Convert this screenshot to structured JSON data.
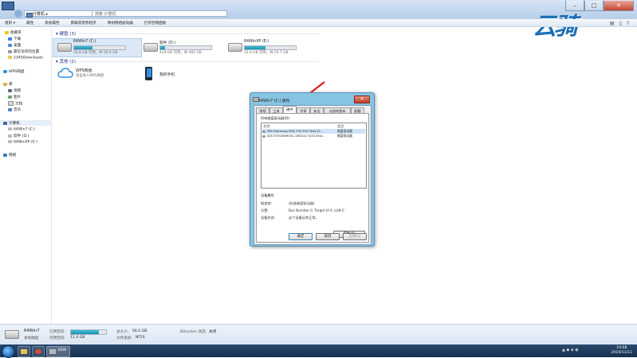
{
  "titlebar": {
    "address": "计算机 ▸",
    "search_placeholder": "搜索 计算机",
    "window_buttons": [
      "–",
      "□",
      "✕"
    ]
  },
  "watermark": "云骑",
  "cmdbar": {
    "items": [
      "组织 ▾",
      "属性",
      "系统属性",
      "卸载或更改程序",
      "映射网络驱动器",
      "打开控制面板"
    ]
  },
  "sidebar": {
    "favorites": {
      "title": "收藏夹",
      "items": [
        "下载",
        "桌面",
        "最近访问的位置",
        "2345Downloads"
      ]
    },
    "wps": "WPS网盘",
    "library": {
      "title": "库",
      "items": [
        "视频",
        "图片",
        "文档",
        "音乐"
      ]
    },
    "computer": {
      "title": "计算机",
      "items": [
        "64Win7 (C:)",
        "软件 (D:)",
        "64WinXP (E:)"
      ]
    },
    "network": "网络"
  },
  "content": {
    "disks_header": "硬盘 (3)",
    "other_header": "其他 (2)",
    "drives": [
      {
        "name": "64Win7 (C:)",
        "size": "35.8 GB 可用，共 56.0 GB",
        "used_fraction": 0.36
      },
      {
        "name": "软件 (D:)",
        "size": "419 GB 可用，共 465 GB",
        "used_fraction": 0.1
      },
      {
        "name": "64WinXP (E:)",
        "size": "32.9 GB 可用，共 55.7 GB",
        "used_fraction": 0.41
      }
    ],
    "others": [
      {
        "name": "WPS网盘",
        "desc": "双击进入WPS网盘"
      },
      {
        "name": "我的手机",
        "desc": ""
      }
    ]
  },
  "dialog": {
    "title": "64Win7 (C:) 属性",
    "close": "✕",
    "tabs": [
      "常规",
      "工具",
      "硬件",
      "共享",
      "安全",
      "以前的版本",
      "配额"
    ],
    "active_tab": "硬件",
    "list_title": "所有磁盘驱动器(D):",
    "columns": [
      "名称",
      "类型"
    ],
    "rows": [
      {
        "name": "ATA Samsung SSD 750 EVO Disk D...",
        "type": "磁盘驱动器"
      },
      {
        "name": "ATA ST500DM002-1BD142 SCSI Disk...",
        "type": "磁盘驱动器"
      }
    ],
    "group_title": "设备属性",
    "props": [
      {
        "label": "制造商:",
        "value": "(标准磁盘驱动器)"
      },
      {
        "label": "位置:",
        "value": "Bus Number 0, Target Id 0, LUN 0"
      },
      {
        "label": "设备状态:",
        "value": "这个设备运转正常。"
      }
    ],
    "properties_button": "属性(R)",
    "ok": "确定",
    "cancel": "取消",
    "apply": "应用(A)"
  },
  "details": {
    "name": "64Win7",
    "type": "本地磁盘",
    "used_label": "已用空间:",
    "free_label": "可用空间:",
    "free": "11.4 GB",
    "total_label": "总大小:",
    "total": "56.0 GB",
    "fs_label": "文件系统:",
    "fs": "NTFS",
    "bitlocker_label": "BitLocker 状态:",
    "bitlocker": "关闭",
    "used_fraction": 0.8
  },
  "taskbar": {
    "app_label": "64W",
    "time": "10:08",
    "date": "2019/11/11"
  },
  "colors": {
    "accent": "#1c8faa",
    "dialog_frame": "#86c4e2",
    "arrow": "#e01b1b"
  }
}
